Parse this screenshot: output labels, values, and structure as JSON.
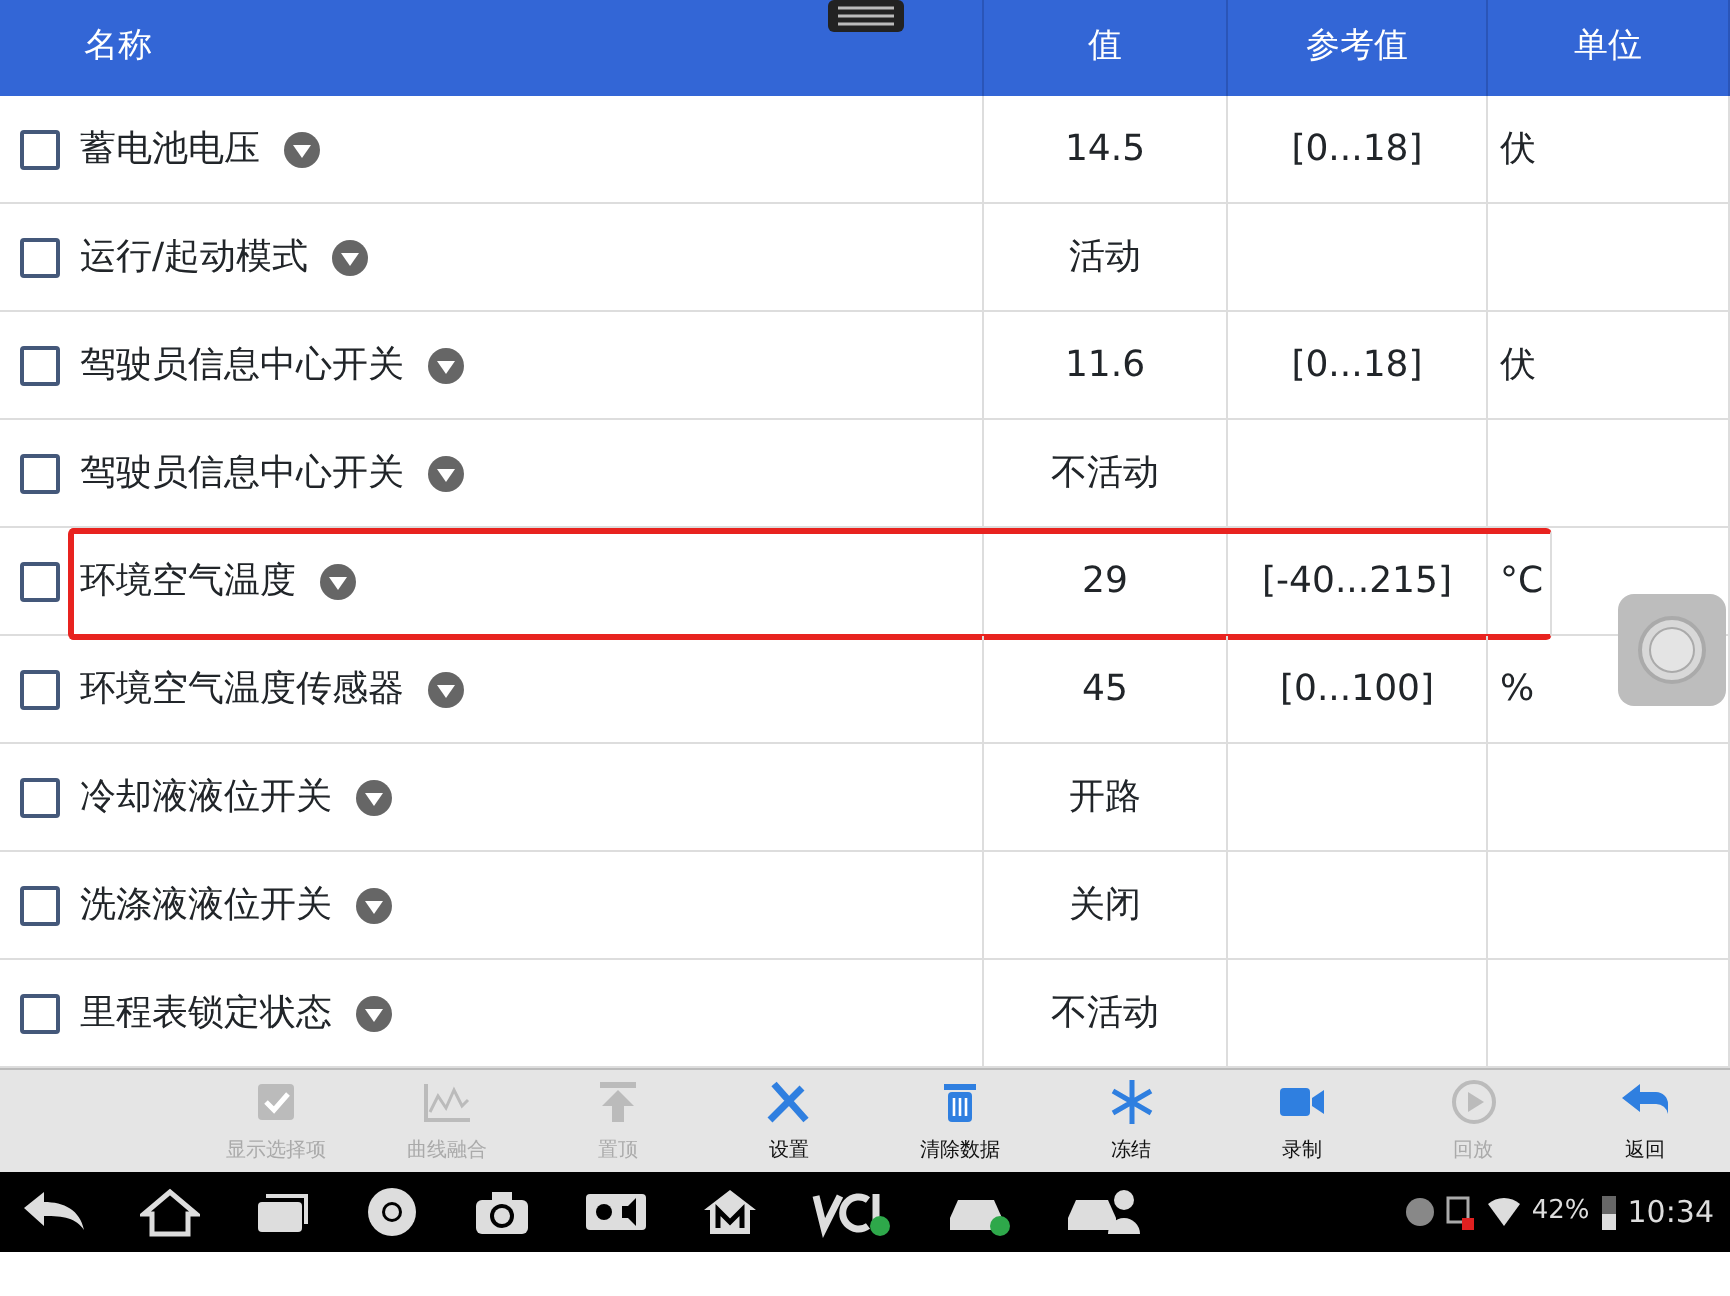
{
  "table": {
    "columns": [
      "名称",
      "值",
      "参考值",
      "单位"
    ],
    "rows": [
      {
        "name": "蓄电池电压",
        "value": "14.5",
        "reference": "[0...18]",
        "unit": "伏",
        "checked": false,
        "highlighted": false
      },
      {
        "name": "运行/起动模式",
        "value": "活动",
        "reference": "",
        "unit": "",
        "checked": false,
        "highlighted": false
      },
      {
        "name": "驾驶员信息中心开关",
        "value": "11.6",
        "reference": "[0...18]",
        "unit": "伏",
        "checked": false,
        "highlighted": false
      },
      {
        "name": "驾驶员信息中心开关",
        "value": "不活动",
        "reference": "",
        "unit": "",
        "checked": false,
        "highlighted": false
      },
      {
        "name": "环境空气温度",
        "value": "29",
        "reference": "[-40...215]",
        "unit": "°C",
        "checked": false,
        "highlighted": true
      },
      {
        "name": "环境空气温度传感器",
        "value": "45",
        "reference": "[0...100]",
        "unit": "%",
        "checked": false,
        "highlighted": false
      },
      {
        "name": "冷却液液位开关",
        "value": "开路",
        "reference": "",
        "unit": "",
        "checked": false,
        "highlighted": false
      },
      {
        "name": "洗涤液液位开关",
        "value": "关闭",
        "reference": "",
        "unit": "",
        "checked": false,
        "highlighted": false
      },
      {
        "name": "里程表锁定状态",
        "value": "不活动",
        "reference": "",
        "unit": "",
        "checked": false,
        "highlighted": false
      }
    ]
  },
  "toolbar": [
    {
      "kind": "checkbox",
      "label": "显示选择项",
      "disabled": true
    },
    {
      "kind": "chart",
      "label": "曲线融合",
      "disabled": true
    },
    {
      "kind": "top",
      "label": "置顶",
      "disabled": true
    },
    {
      "kind": "tools",
      "label": "设置",
      "disabled": false
    },
    {
      "kind": "trash",
      "label": "清除数据",
      "disabled": false
    },
    {
      "kind": "snow",
      "label": "冻结",
      "disabled": false
    },
    {
      "kind": "video",
      "label": "录制",
      "disabled": false
    },
    {
      "kind": "play",
      "label": "回放",
      "disabled": true
    },
    {
      "kind": "back",
      "label": "返回",
      "disabled": false
    }
  ],
  "status_bar": {
    "battery": "42%",
    "time": "10:34"
  }
}
